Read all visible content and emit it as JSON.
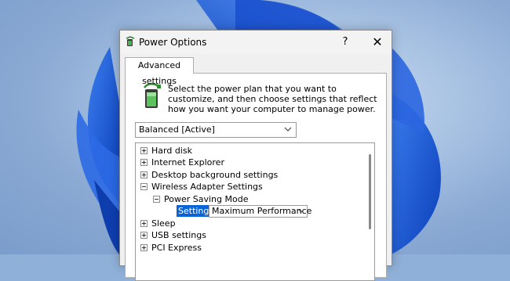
{
  "window": {
    "title": "Power Options",
    "help_glyph": "?",
    "close_glyph": "✕"
  },
  "tab": {
    "label": "Advanced settings"
  },
  "description": "Select the power plan that you want to customize, and then choose settings that reflect how you want your computer to manage power.",
  "plan_select": {
    "value": "Balanced [Active]"
  },
  "tree": {
    "items": [
      {
        "label": "Hard disk",
        "expander": "plus"
      },
      {
        "label": "Internet Explorer",
        "expander": "plus"
      },
      {
        "label": "Desktop background settings",
        "expander": "plus"
      },
      {
        "label": "Wireless Adapter Settings",
        "expander": "minus"
      },
      {
        "label": "Power Saving Mode",
        "expander": "minus"
      },
      {
        "label": "Sleep",
        "expander": "plus"
      },
      {
        "label": "USB settings",
        "expander": "plus"
      },
      {
        "label": "PCI Express",
        "expander": "plus"
      }
    ],
    "setting_label": "Setting:",
    "setting_value": "Maximum Performance"
  },
  "colors": {
    "selection": "#0a64d6",
    "wallpaper_blue": "#1f5fd6"
  }
}
